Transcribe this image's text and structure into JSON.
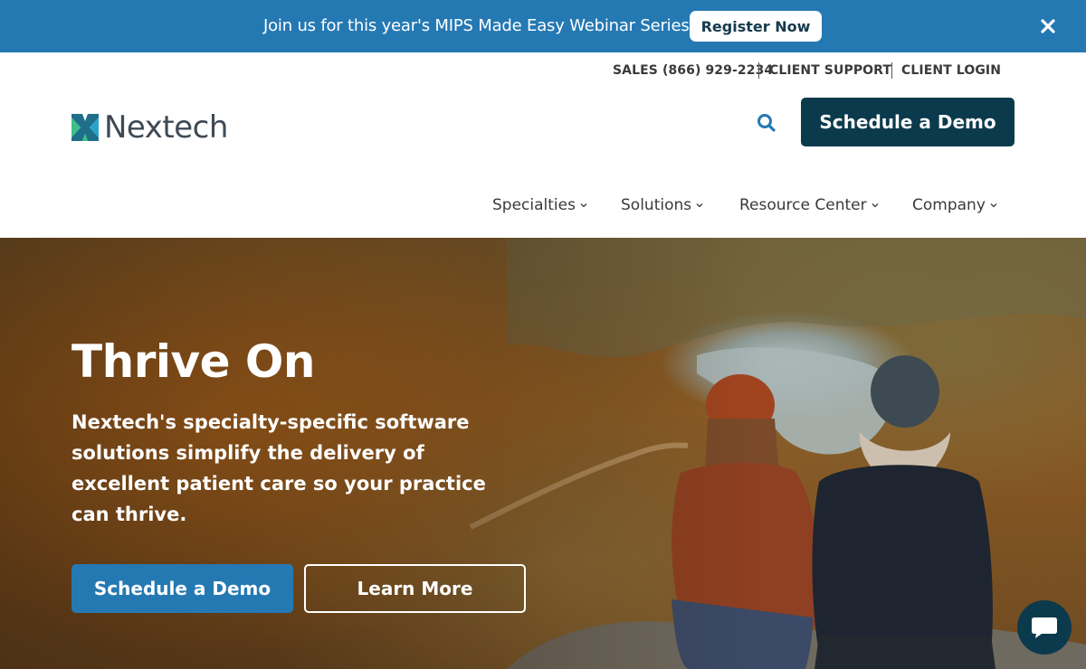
{
  "announcement": {
    "text": "Join us for this year's MIPS Made Easy Webinar Series!",
    "button_label": "Register Now",
    "close_icon": "close-icon"
  },
  "utility_nav": {
    "sales": "SALES (866) 929-2234",
    "support": "CLIENT SUPPORT",
    "login": "CLIENT LOGIN"
  },
  "brand": {
    "name": "Nextech",
    "logo_icon": "nextech-logo-mark"
  },
  "header": {
    "search_icon": "search-icon",
    "demo_button": "Schedule a Demo"
  },
  "main_nav": {
    "items": [
      {
        "label": "Specialties"
      },
      {
        "label": "Solutions"
      },
      {
        "label": "Resource Center"
      },
      {
        "label": "Company"
      }
    ]
  },
  "hero": {
    "title": "Thrive On",
    "subtitle": "Nextech's specialty-specific software solutions simplify the delivery of excellent patient care so your practice can thrive.",
    "primary_button": "Schedule a Demo",
    "secondary_button": "Learn More"
  },
  "chat": {
    "icon": "chat-icon"
  },
  "colors": {
    "announcement_bg": "#2579b3",
    "primary_dark": "#0c3a4d",
    "accent_blue": "#2579b3",
    "logo_green": "#3dbf85",
    "logo_teal": "#1f6f8b"
  }
}
